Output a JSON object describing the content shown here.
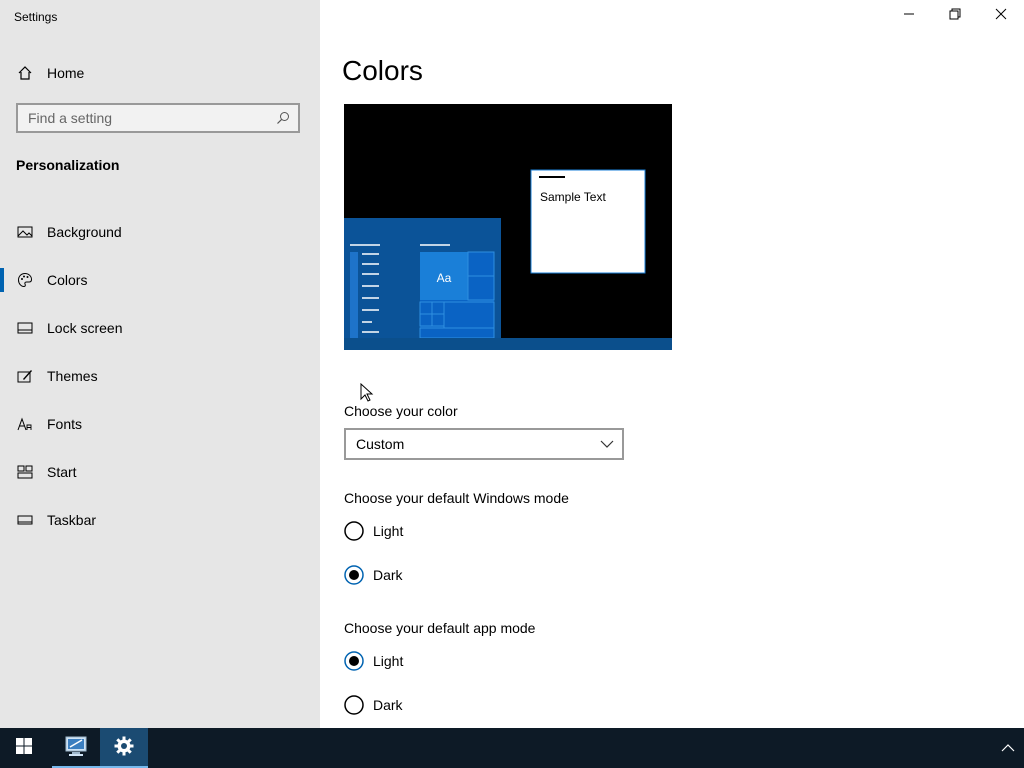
{
  "window": {
    "title": "Settings"
  },
  "sidebar": {
    "home_label": "Home",
    "search_placeholder": "Find a setting",
    "section_title": "Personalization",
    "items": [
      {
        "label": "Background",
        "icon": "image-icon",
        "active": false
      },
      {
        "label": "Colors",
        "icon": "palette-icon",
        "active": true
      },
      {
        "label": "Lock screen",
        "icon": "lock-screen-icon",
        "active": false
      },
      {
        "label": "Themes",
        "icon": "themes-icon",
        "active": false
      },
      {
        "label": "Fonts",
        "icon": "fonts-icon",
        "active": false
      },
      {
        "label": "Start",
        "icon": "start-icon",
        "active": false
      },
      {
        "label": "Taskbar",
        "icon": "taskbar-icon",
        "active": false
      }
    ]
  },
  "main": {
    "title": "Colors",
    "preview": {
      "sample_text": "Sample Text",
      "tile_label": "Aa"
    },
    "choose_color": {
      "label": "Choose your color",
      "value": "Custom"
    },
    "windows_mode": {
      "label": "Choose your default Windows mode",
      "options": [
        {
          "label": "Light",
          "selected": false
        },
        {
          "label": "Dark",
          "selected": true
        }
      ]
    },
    "app_mode": {
      "label": "Choose your default app mode",
      "options": [
        {
          "label": "Light",
          "selected": true
        },
        {
          "label": "Dark",
          "selected": false
        }
      ]
    }
  },
  "colors": {
    "accent": "#0063b1",
    "sidebar_bg": "#e6e6e6",
    "taskbar_bg": "#0d1a26"
  }
}
